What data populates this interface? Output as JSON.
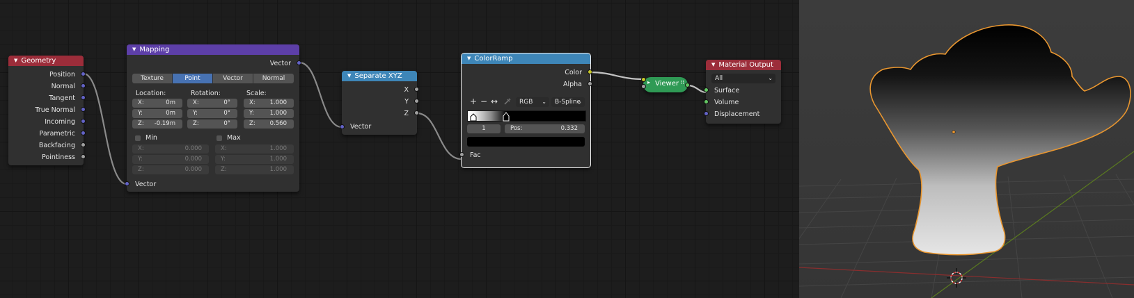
{
  "colors": {
    "input_header": "#9c2d3a",
    "converter_header": "#5d3fa8",
    "vector_header": "#3e86b8",
    "output_header": "#9c2d3a",
    "viewer": "#2f9a55",
    "selection_outline": "#e9962f"
  },
  "nodes": {
    "geometry": {
      "title": "Geometry",
      "outputs": [
        "Position",
        "Normal",
        "Tangent",
        "True Normal",
        "Incoming",
        "Parametric",
        "Backfacing",
        "Pointiness"
      ]
    },
    "mapping": {
      "title": "Mapping",
      "output": "Vector",
      "modes": [
        "Texture",
        "Point",
        "Vector",
        "Normal"
      ],
      "active_mode": "Point",
      "location_label": "Location:",
      "rotation_label": "Rotation:",
      "scale_label": "Scale:",
      "location": [
        {
          "axis": "X:",
          "value": "0m"
        },
        {
          "axis": "Y:",
          "value": "0m"
        },
        {
          "axis": "Z:",
          "value": "-0.19m"
        }
      ],
      "rotation": [
        {
          "axis": "X:",
          "value": "0°"
        },
        {
          "axis": "Y:",
          "value": "0°"
        },
        {
          "axis": "Z:",
          "value": "0°"
        }
      ],
      "scale": [
        {
          "axis": "X:",
          "value": "1.000"
        },
        {
          "axis": "Y:",
          "value": "1.000"
        },
        {
          "axis": "Z:",
          "value": "0.560"
        }
      ],
      "min_label": "Min",
      "max_label": "Max",
      "min": [
        {
          "axis": "X:",
          "value": "0.000"
        },
        {
          "axis": "Y:",
          "value": "0.000"
        },
        {
          "axis": "Z:",
          "value": "0.000"
        }
      ],
      "max": [
        {
          "axis": "X:",
          "value": "1.000"
        },
        {
          "axis": "Y:",
          "value": "1.000"
        },
        {
          "axis": "Z:",
          "value": "1.000"
        }
      ],
      "input": "Vector"
    },
    "separate": {
      "title": "Separate XYZ",
      "outputs": [
        "X",
        "Y",
        "Z"
      ],
      "input": "Vector"
    },
    "colorramp": {
      "title": "ColorRamp",
      "outputs": [
        "Color",
        "Alpha"
      ],
      "add_icon": "+",
      "remove_icon": "−",
      "flip_icon": "↔",
      "color_mode": "RGB",
      "interpolation": "B-Spline",
      "stop_index": "1",
      "pos_label": "Pos:",
      "pos_value": "0.332",
      "input": "Fac"
    },
    "viewer": {
      "title": "Viewer"
    },
    "material_output": {
      "title": "Material Output",
      "target": "All",
      "inputs": [
        "Surface",
        "Volume",
        "Displacement"
      ]
    }
  },
  "icons": {
    "collapse": "triangle-down-icon",
    "eyedropper": "eyedropper-icon",
    "cursor": "3d-cursor-icon",
    "origin": "object-origin-icon"
  }
}
